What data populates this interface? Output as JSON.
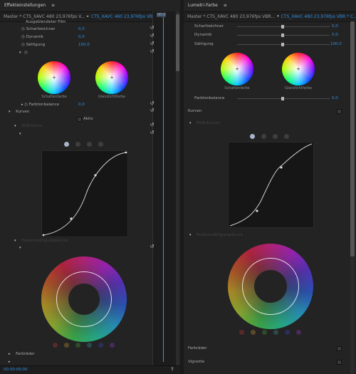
{
  "effects_panel": {
    "tab_title": "Effekteinstellungen",
    "tab_menu": "≡",
    "source_master": "Master * CTS_XAVC 480 23,976fps V...",
    "source_clip": "CTS_XAVC 480 23,976fps VBR * C...",
    "timeline_label": "00:0",
    "rows": {
      "truncated_label": "Ausgeblendeter Film",
      "sharpen_label": "Scharfzeichner",
      "sharpen_value": "0,0",
      "vibrance_label": "Dynamik",
      "vibrance_value": "0,0",
      "saturation_label": "Sättigung",
      "saturation_value": "100,0"
    },
    "wheel_shadow_caption": "Schattenfarbe",
    "wheel_highlight_caption": "Glanzlichtfarbe",
    "color_balance_label": "Farbtonbalance",
    "color_balance_value": "0,0",
    "curves_label": "Kurven",
    "curves_toggle_label": "Aktiv",
    "curves_sub_label": "RGB-Kurve",
    "hue_sat_label": "Farbtonsättigungskurve",
    "color_wheels_label": "Farbräder",
    "timecode": "00:00:00:00"
  },
  "lumetri_panel": {
    "tab_title": "Lumetri-Farbe",
    "tab_menu": "≡",
    "source_master": "Master * CTS_XAVC 480 23,976fps VBR...",
    "source_clip": "CTS_XAVC 480 23,976fps VBR * C...",
    "sharpen_label": "Scharfzeichner",
    "sharpen_value": "0,0",
    "vibrance_label": "Dynamik",
    "vibrance_value": "0,0",
    "saturation_label": "Sättigung",
    "saturation_value": "100,0",
    "wheel_shadow_caption": "Schattenfarbe",
    "wheel_highlight_caption": "Glanzlichtfarbe",
    "color_balance_label": "Farbtonbalance",
    "color_balance_value": "0,0",
    "curves_label": "Kurven",
    "curves_sub_label": "RGB-Kurven",
    "hue_sat_label": "Farbtonsättigungskurve",
    "color_wheels_label": "Farbräder",
    "vignette_label": "Vignette"
  },
  "channel_colors": [
    "#aab4c8",
    "#3e3e3e",
    "#3e3e3e",
    "#3e3e3e"
  ],
  "hue_swatch_colors": [
    "#5a2a2a",
    "#5a4a2a",
    "#2f4a2a",
    "#2a4a4a",
    "#2a2f5a",
    "#4a2a5a"
  ],
  "accent_color": "#2f8fe0"
}
